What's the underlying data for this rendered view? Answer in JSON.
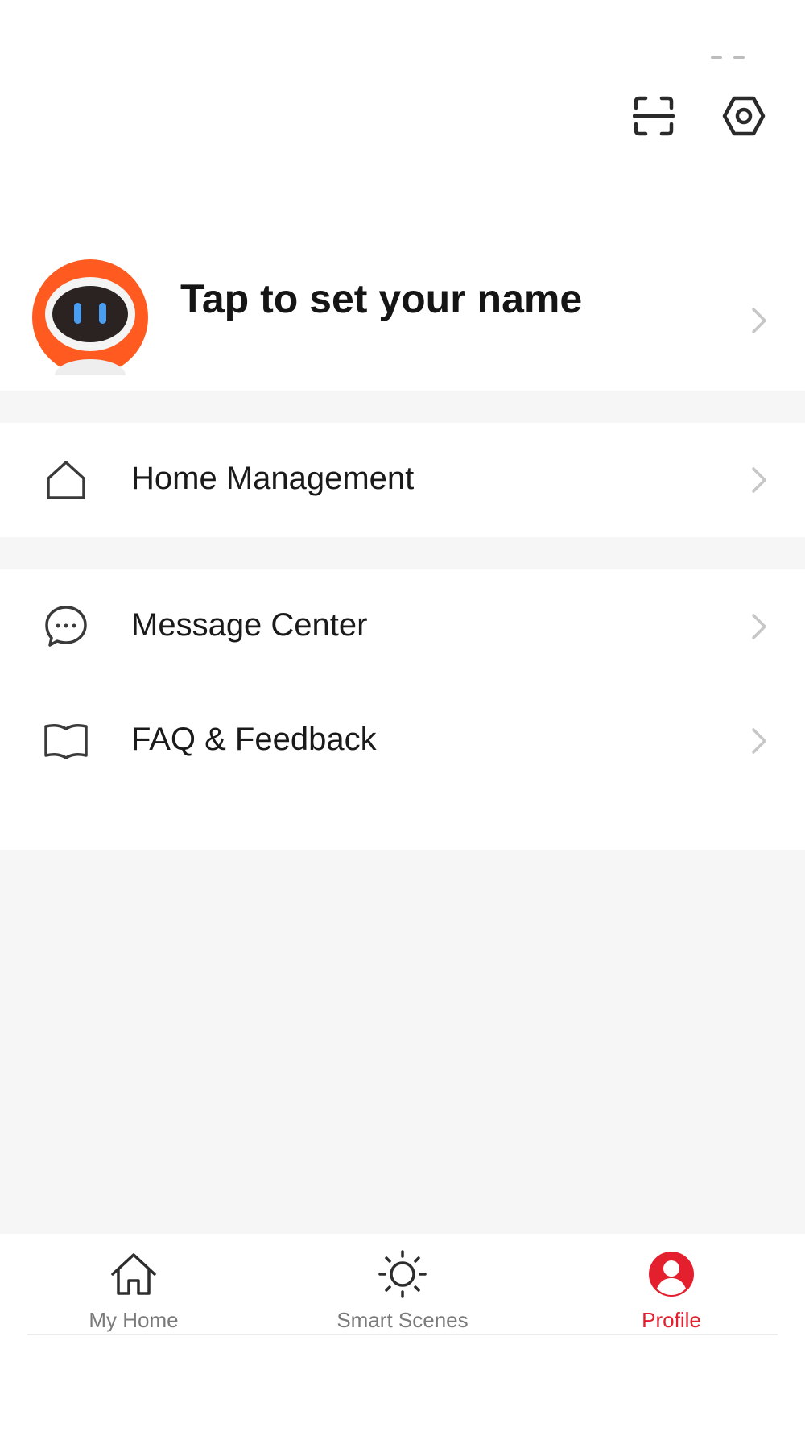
{
  "header": {
    "scan_icon": "scan-icon",
    "settings_icon": "settings-hex-icon"
  },
  "profile": {
    "name_prompt": "Tap to set your name",
    "avatar_icon": "robot-avatar-icon",
    "avatar_color": "#ff5a1f"
  },
  "menu": {
    "items": [
      {
        "label": "Home Management",
        "icon": "home-outline-icon"
      },
      {
        "label": "Message Center",
        "icon": "chat-bubble-icon"
      },
      {
        "label": "FAQ & Feedback",
        "icon": "open-book-icon"
      }
    ]
  },
  "bottom_nav": {
    "tabs": [
      {
        "label": "My Home",
        "icon": "house-icon",
        "active": false
      },
      {
        "label": "Smart Scenes",
        "icon": "sun-icon",
        "active": false
      },
      {
        "label": "Profile",
        "icon": "person-circle-icon",
        "active": true
      }
    ],
    "active_color": "#e5202e"
  }
}
